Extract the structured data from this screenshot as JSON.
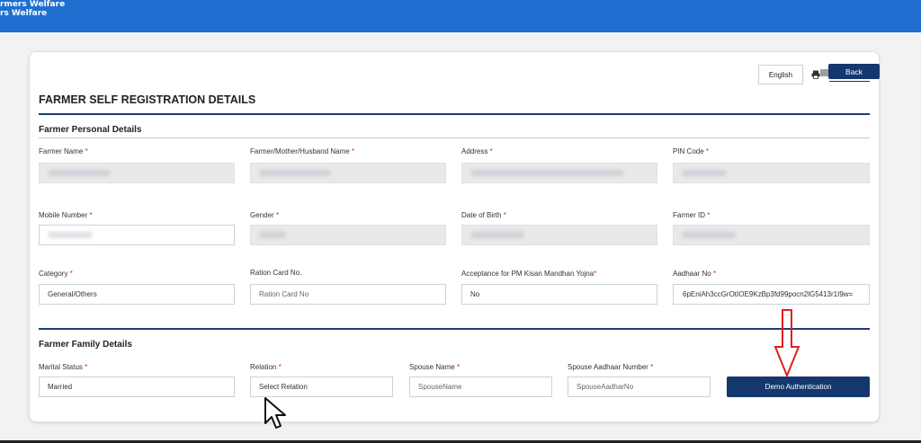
{
  "header": {
    "line1": "rmers Welfare",
    "line2": "rs Welfare"
  },
  "toolbar": {
    "language_label": "English",
    "print_icon": "print-icon",
    "document_icon": "document-icon",
    "back_label": "Back"
  },
  "page": {
    "title": "FARMER SELF REGISTRATION DETAILS"
  },
  "personal": {
    "section_title": "Farmer Personal Details",
    "farmer_name": {
      "label": "Farmer Name",
      "required": "*"
    },
    "relative_name": {
      "label": "Farmer/Mother/Husband Name",
      "required": "*"
    },
    "address": {
      "label": "Address",
      "required": "*"
    },
    "pin_code": {
      "label": "PIN Code",
      "required": "*"
    },
    "mobile": {
      "label": "Mobile Number",
      "required": "*"
    },
    "gender": {
      "label": "Gender",
      "required": "*"
    },
    "dob": {
      "label": "Date of Birth",
      "required": "*"
    },
    "farmer_id": {
      "label": "Farmer ID",
      "required": "*"
    },
    "category": {
      "label": "Category",
      "required": "*",
      "value": "General/Others"
    },
    "ration_card": {
      "label": "Ration Card No.",
      "placeholder": "Ration Card No"
    },
    "pm_kisan": {
      "label": "Acceptance for PM Kisan Mandhan Yojna",
      "required": "*",
      "value": "No"
    },
    "aadhaar": {
      "label": "Aadhaar No",
      "required": "*",
      "value": "6pEniAh3ccGrOtIOE9KzBp3fd99pocn2lG5413r1I9w="
    }
  },
  "family": {
    "section_title": "Farmer Family Details",
    "marital_status": {
      "label": "Marital Status",
      "required": "*",
      "value": "Married"
    },
    "relation": {
      "label": "Relation",
      "required": "*",
      "value": "Select Relation"
    },
    "spouse_name": {
      "label": "Spouse Name",
      "required": "*",
      "placeholder": "SpouseName"
    },
    "spouse_aadhaar": {
      "label": "Spouse Aadhaar Number",
      "required": "*",
      "placeholder": "SpouseAadharNo"
    },
    "demo_auth_label": "Demo Authentication"
  },
  "annotations": {
    "arrow_color": "#e02020",
    "accent_color": "#14386e",
    "topbar_color": "#1f6fd0"
  }
}
